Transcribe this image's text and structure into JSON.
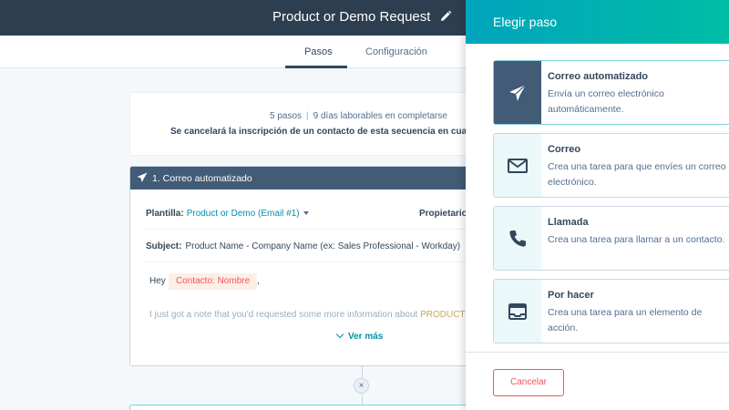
{
  "header": {
    "title": "Product or Demo Request",
    "edit_icon": "pencil-icon"
  },
  "tabs": [
    {
      "label": "Pasos",
      "active": true
    },
    {
      "label": "Configuración",
      "active": false
    }
  ],
  "summary": {
    "steps": "5 pasos",
    "separator": "|",
    "days": "9 días laborables en completarse",
    "note": "Se cancelará la inscripción de un contacto de esta secuencia en cualqu"
  },
  "step": {
    "header": "1. Correo automatizado",
    "template_label": "Plantilla:",
    "template_value": "Product or Demo (Email #1)",
    "owner_label": "Propietario",
    "subject_label": "Subject:",
    "subject_value": "Product Name - Company Name (ex: Sales Professional - Workday)",
    "greeting": "Hey",
    "token": "Contacto: Nombre",
    "comma": ",",
    "body": "I just got a note that you'd requested some more information about",
    "body_highlight": "PRODUCT",
    "more": "Ver más",
    "remove": "×"
  },
  "panel": {
    "title": "Elegir paso",
    "options": [
      {
        "title": "Correo automatizado",
        "desc": "Envía un correo electrónico automáticamente.",
        "icon": "paper-plane-icon",
        "selected": true
      },
      {
        "title": "Correo",
        "desc": "Crea una tarea para que envíes un correo electrónico.",
        "icon": "envelope-icon",
        "selected": false
      },
      {
        "title": "Llamada",
        "desc": "Crea una tarea para llamar a un contacto.",
        "icon": "phone-icon",
        "selected": false
      },
      {
        "title": "Por hacer",
        "desc": "Crea una tarea para un elemento de acción.",
        "icon": "inbox-tray-icon",
        "selected": false
      }
    ],
    "cancel": "Cancelar"
  },
  "colors": {
    "header": "#2d3e50",
    "panel_gradient_start": "#00a4bd",
    "panel_gradient_end": "#00bda5",
    "selected_icon_bg": "#425b76",
    "accent": "#0091ae",
    "danger": "#f2545b"
  }
}
